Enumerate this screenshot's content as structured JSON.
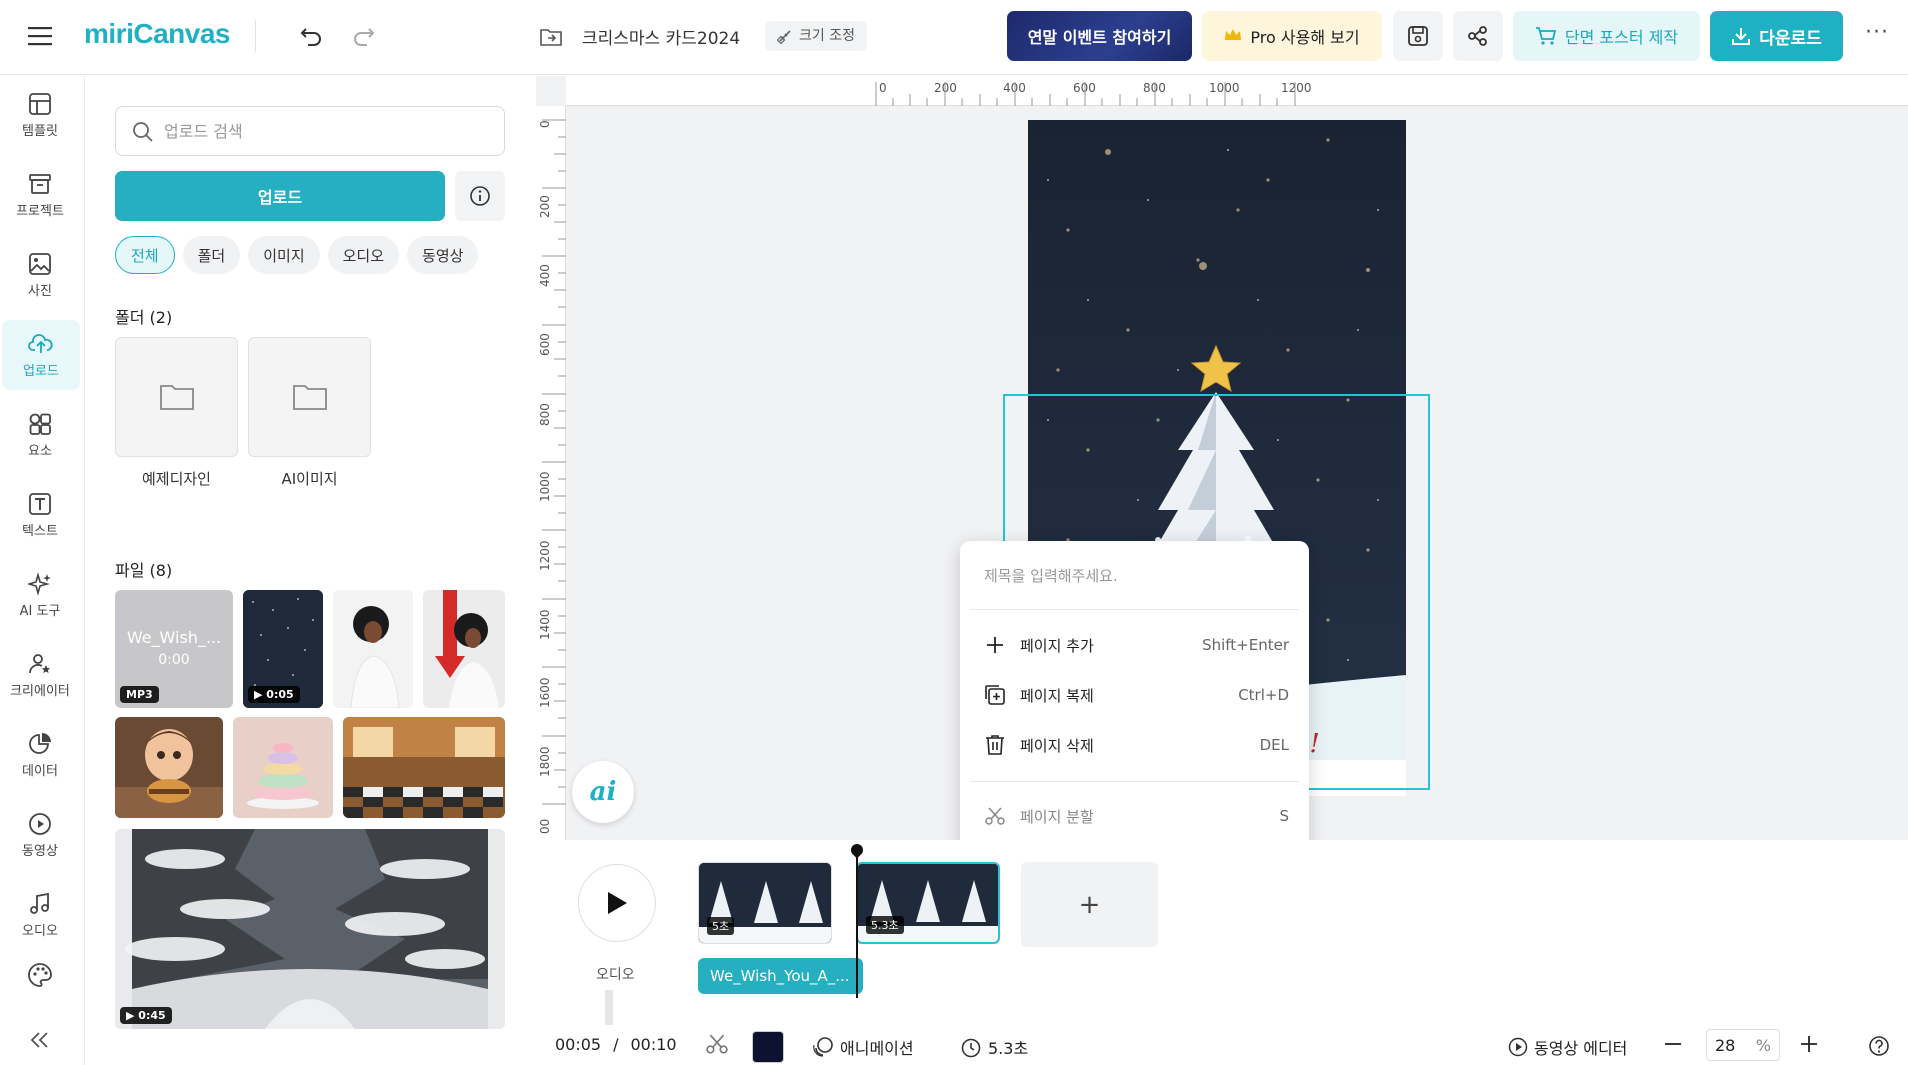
{
  "topbar": {
    "logo": "miriCanvas",
    "document_title": "크리스마스 카드2024",
    "resize_label": "크기 조정",
    "event_label": "연말 이벤트 참여하기",
    "pro_label": "Pro 사용해 보기",
    "poster_label": "단면 포스터 제작",
    "download_label": "다운로드",
    "more_label": "···"
  },
  "rail": {
    "items": [
      {
        "label": "템플릿",
        "icon": "template-icon"
      },
      {
        "label": "프로젝트",
        "icon": "project-icon"
      },
      {
        "label": "사진",
        "icon": "photo-icon"
      },
      {
        "label": "업로드",
        "icon": "upload-cloud-icon"
      },
      {
        "label": "요소",
        "icon": "elements-icon"
      },
      {
        "label": "텍스트",
        "icon": "text-icon"
      },
      {
        "label": "AI 도구",
        "icon": "ai-sparkle-icon"
      },
      {
        "label": "크리에이터",
        "icon": "creator-icon"
      },
      {
        "label": "데이터",
        "icon": "data-chart-icon"
      },
      {
        "label": "동영상",
        "icon": "video-play-icon"
      },
      {
        "label": "오디오",
        "icon": "music-note-icon"
      }
    ],
    "active_index": 3
  },
  "panel": {
    "search_placeholder": "업로드 검색",
    "upload_label": "업로드",
    "chips": [
      "전체",
      "폴더",
      "이미지",
      "오디오",
      "동영상"
    ],
    "active_chip": 0,
    "folders_header": "폴더 (2)",
    "folders": [
      "예제디자인",
      "AI이미지"
    ],
    "files_header": "파일 (8)",
    "files": [
      {
        "name": "We_Wish_...",
        "duration": "0:00",
        "badge": "MP3"
      },
      {
        "badge": "0:05"
      },
      {
        "badge": ""
      },
      {
        "badge": ""
      },
      {
        "badge": ""
      },
      {
        "badge": ""
      },
      {
        "badge": ""
      },
      {
        "badge": "0:45"
      }
    ]
  },
  "ruler": {
    "h_labels": [
      "0",
      "200",
      "400",
      "600",
      "800",
      "1000",
      "1200"
    ],
    "v_labels": [
      "0",
      "200",
      "400",
      "600",
      "800",
      "1000",
      "1200",
      "1400",
      "1600",
      "1800",
      "00"
    ]
  },
  "canvas": {
    "partial_text": "s!"
  },
  "context_menu": {
    "title_placeholder": "제목을 입력해주세요.",
    "items": [
      {
        "label": "페이지 추가",
        "shortcut": "Shift+Enter",
        "icon": "plus-icon"
      },
      {
        "label": "페이지 복제",
        "shortcut": "Ctrl+D",
        "icon": "duplicate-page-icon"
      },
      {
        "label": "페이지 삭제",
        "shortcut": "DEL",
        "icon": "trash-icon"
      }
    ],
    "disabled_item": {
      "label": "페이지 분할",
      "shortcut": "S",
      "icon": "scissors-icon"
    }
  },
  "timeline": {
    "audio_label": "오디오",
    "clips": [
      {
        "time": "5초"
      },
      {
        "time": "5.3초"
      }
    ],
    "audio_clip": "We_Wish_You_A_..."
  },
  "bottombar": {
    "current_time": "00:05",
    "separator": "/",
    "total_time": "00:10",
    "animation_label": "애니메이션",
    "duration_label": "5.3초",
    "video_editor_label": "동영상 에디터",
    "zoom_value": "28",
    "zoom_unit": "%"
  },
  "colors": {
    "accent": "#1fb1c3",
    "event_bg": "#1d2a6b",
    "page_bg": "#1c2635",
    "swatch": "#0d1230"
  }
}
